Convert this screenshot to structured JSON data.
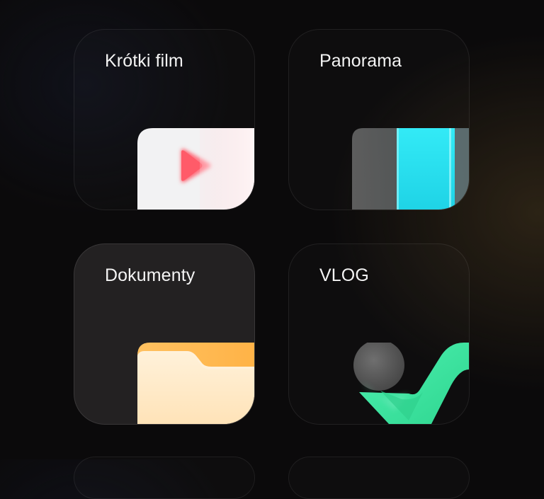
{
  "tiles": [
    {
      "label": "Krótki film",
      "icon": "play-icon",
      "accent": "#ff5a6a"
    },
    {
      "label": "Panorama",
      "icon": "panorama-icon",
      "accent": "#2ee6f2"
    },
    {
      "label": "Dokumenty",
      "icon": "folder-icon",
      "accent": "#ffb84d"
    },
    {
      "label": "VLOG",
      "icon": "vlog-icon",
      "accent": "#3de3a0"
    }
  ]
}
